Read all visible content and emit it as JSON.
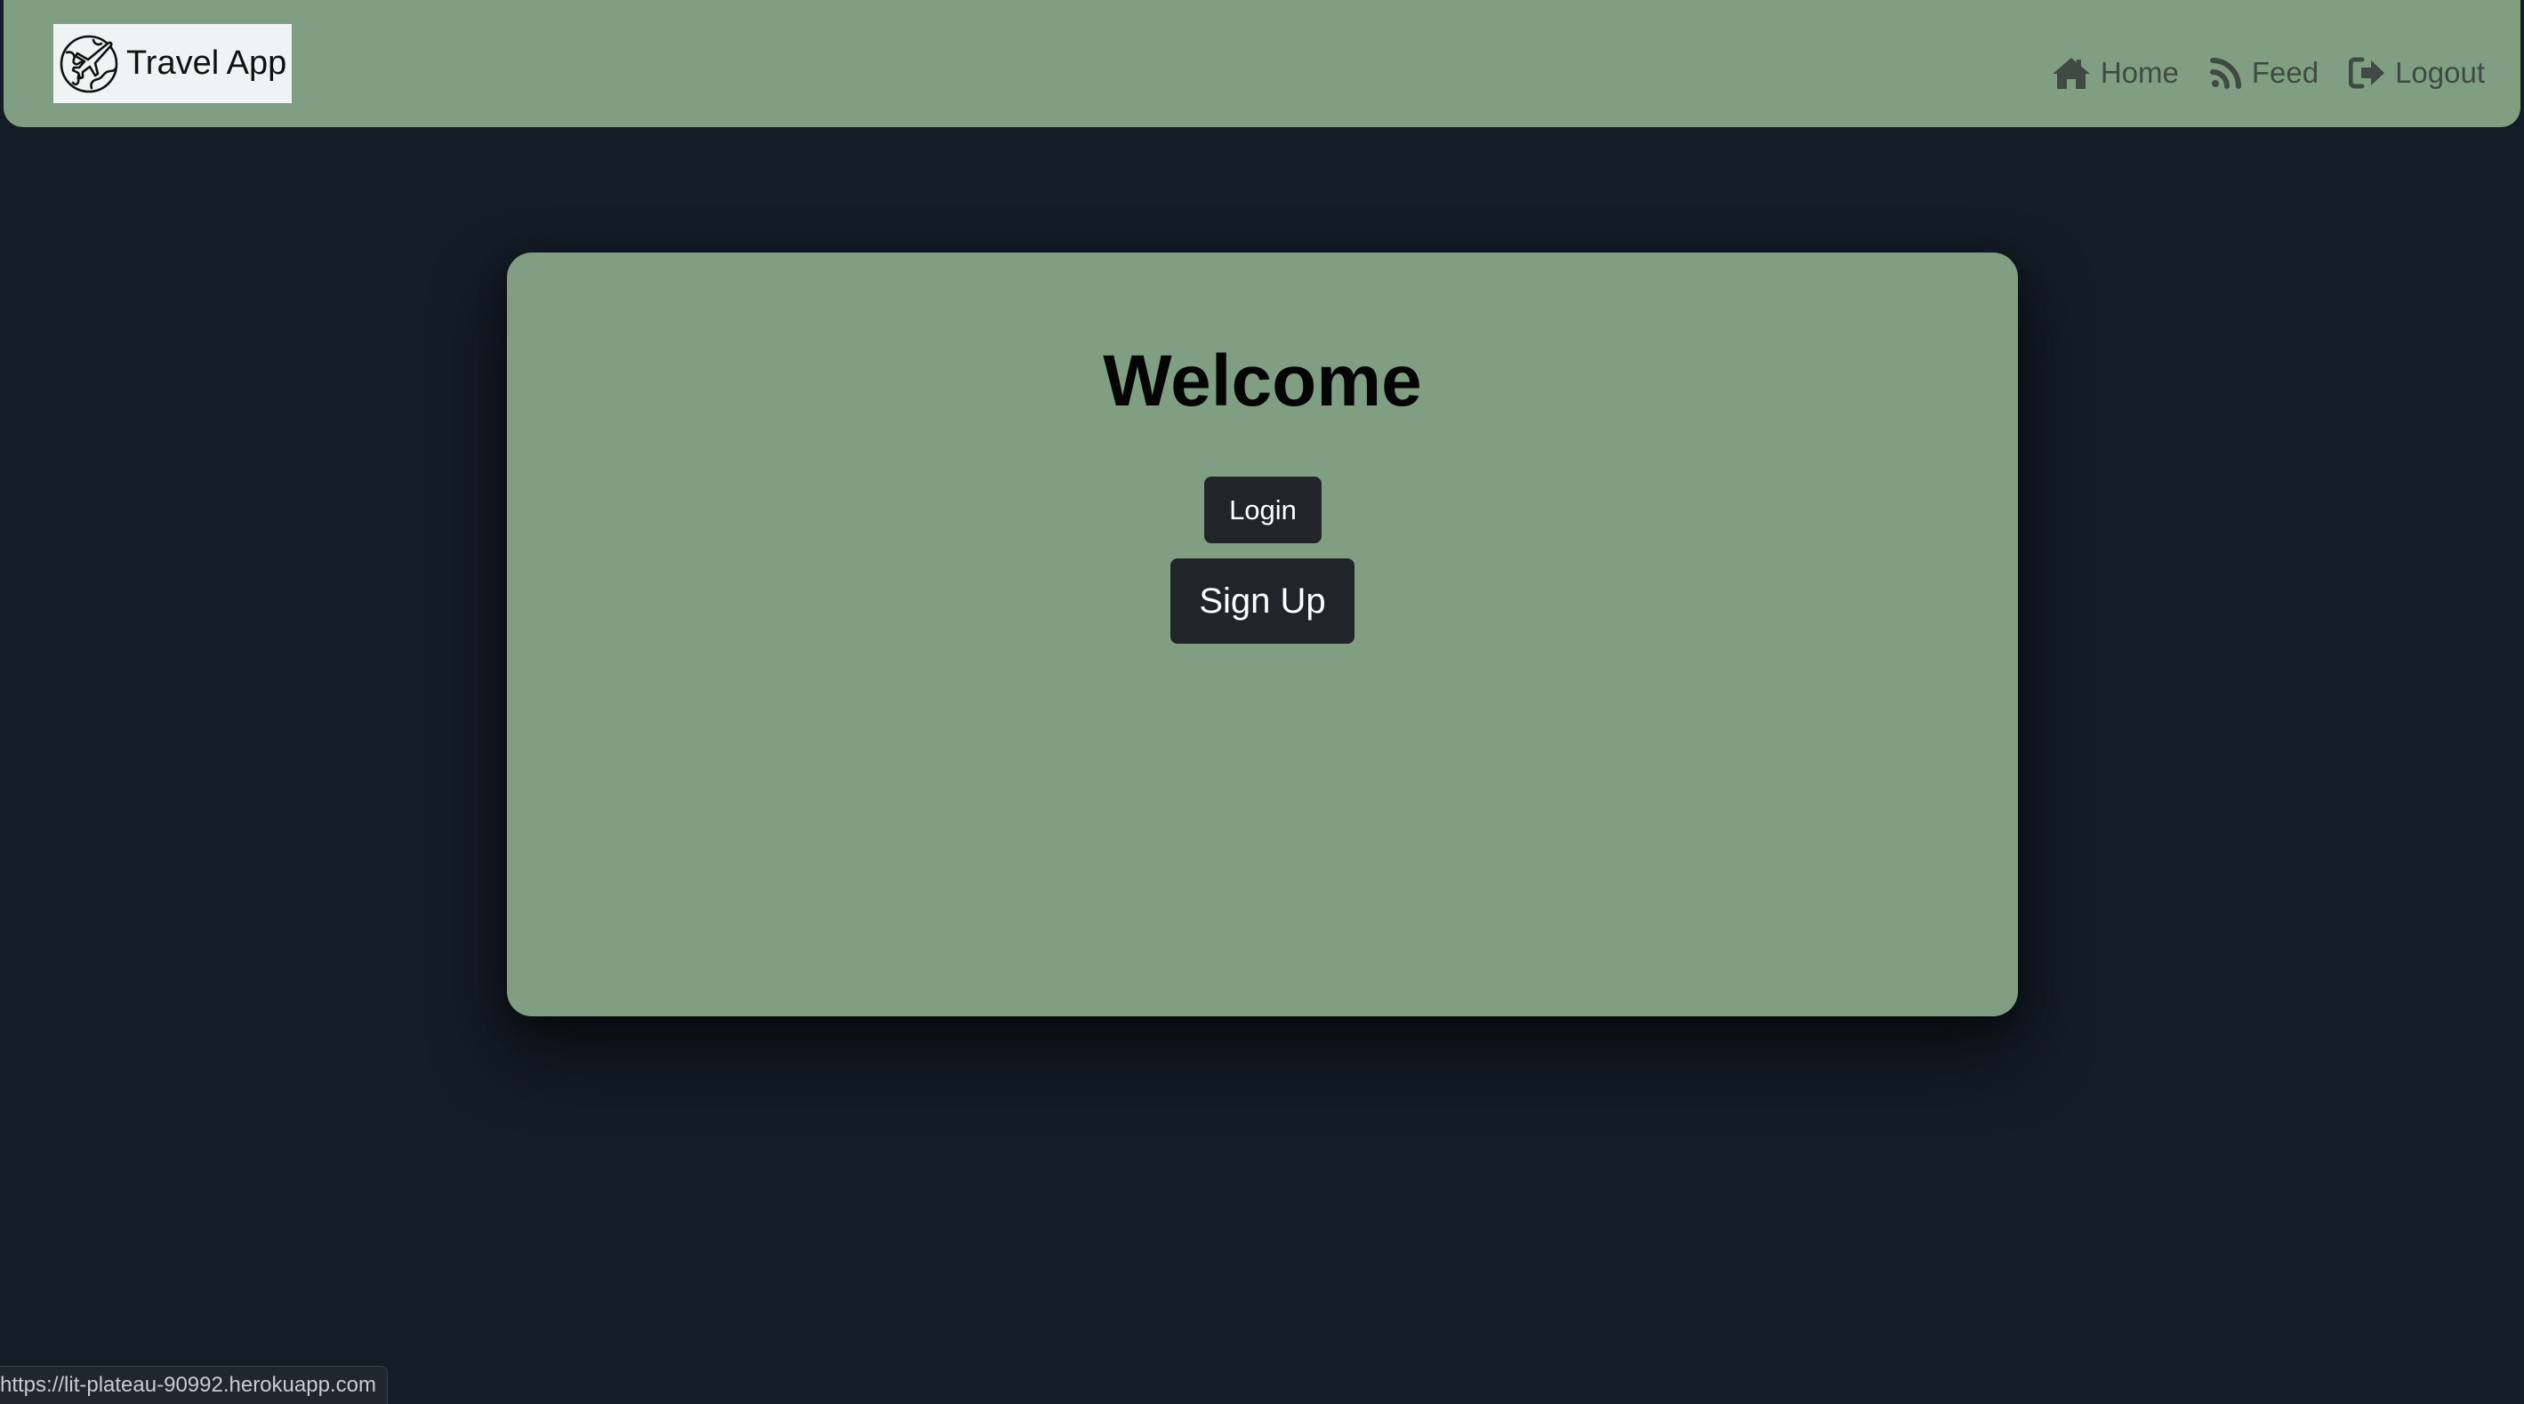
{
  "navbar": {
    "brand": {
      "logo_icon": "globe-airplane-icon",
      "text": "Travel App"
    },
    "links": [
      {
        "label": "Home",
        "icon": "home-icon"
      },
      {
        "label": "Feed",
        "icon": "rss-feed-icon"
      },
      {
        "label": "Logout",
        "icon": "logout-icon"
      }
    ]
  },
  "main": {
    "heading": "Welcome",
    "login_label": "Login",
    "signup_label": "Sign Up"
  },
  "status_bar": {
    "url": "https://lit-plateau-90992.herokuapp.com"
  },
  "colors": {
    "background": "#141c26",
    "panel_green": "#809f82",
    "button_dark": "#212529",
    "nav_link": "#3f4a42"
  }
}
